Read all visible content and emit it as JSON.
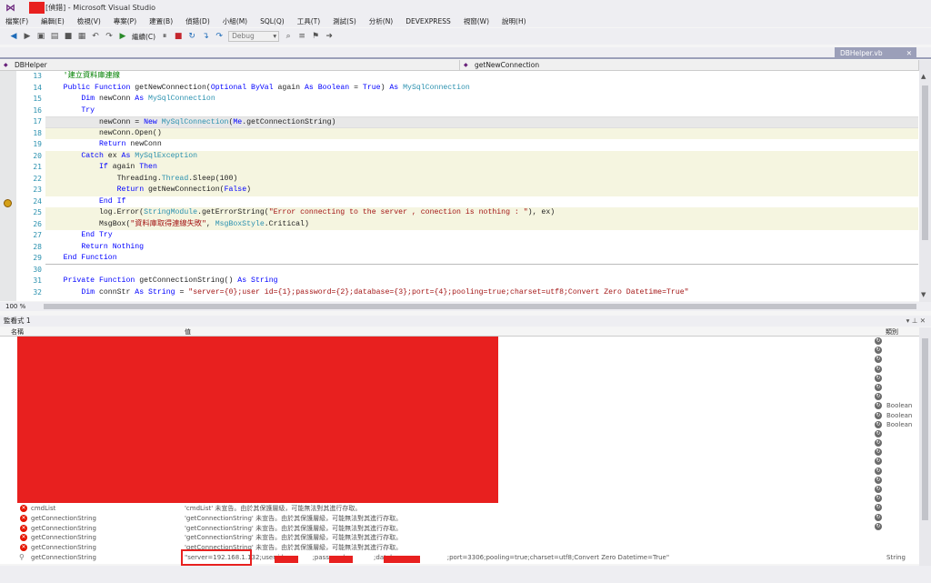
{
  "window": {
    "title": "[偵錯] - Microsoft Visual Studio"
  },
  "menu": [
    "檔案(F)",
    "編輯(E)",
    "檢視(V)",
    "專案(P)",
    "建置(B)",
    "偵錯(D)",
    "小組(M)",
    "SQL(Q)",
    "工具(T)",
    "測試(S)",
    "分析(N)",
    "DEVEXPRESS",
    "視窗(W)",
    "說明(H)"
  ],
  "toolbar": {
    "continue_label": "繼續(C)",
    "config_value": "Debug"
  },
  "tabs": {
    "active_document": "DBHelper.vb"
  },
  "nav": {
    "class_combo": "DBHelper",
    "member_combo": "getNewConnection"
  },
  "editor": {
    "line_numbers": [
      "13",
      "14",
      "15",
      "16",
      "17",
      "18",
      "19",
      "20",
      "21",
      "22",
      "23",
      "24",
      "25",
      "26",
      "27",
      "28",
      "29",
      "30",
      "31",
      "32"
    ],
    "zoom": "100 %"
  },
  "watch": {
    "title": "監看式 1",
    "col_name": "名稱",
    "col_value": "值",
    "col_type": "類別",
    "types": [
      "",
      "",
      "",
      "",
      "",
      "",
      "",
      "Boolean",
      "Boolean",
      "Boolean",
      "",
      "",
      "",
      "",
      "",
      "",
      "",
      "",
      "",
      "",
      ""
    ],
    "rows": [
      {
        "name": "cmdList",
        "value": "'cmdList' 未宣告。由於其保護層級，可能無法對其進行存取。"
      },
      {
        "name": "getConnectionString",
        "value": "'getConnectionString' 未宣告。由於其保護層級，可能無法對其進行存取。"
      },
      {
        "name": "getConnectionString",
        "value": "'getConnectionString' 未宣告。由於其保護層級，可能無法對其進行存取。"
      },
      {
        "name": "getConnectionString",
        "value": "'getConnectionString' 未宣告。由於其保護層級，可能無法對其進行存取。"
      },
      {
        "name": "getConnectionString",
        "value": "'getConnectionString' 未宣告。由於其保護層級，可能無法對其進行存取。"
      }
    ],
    "final_row": {
      "name": "getConnectionString",
      "value_parts": [
        "\"server=192.168.1.132",
        ";user id=",
        ";password=",
        ";database=",
        ";port=3306;pooling=true;charset=utf8;Convert Zero Datetime=True\""
      ],
      "type": "String"
    }
  }
}
